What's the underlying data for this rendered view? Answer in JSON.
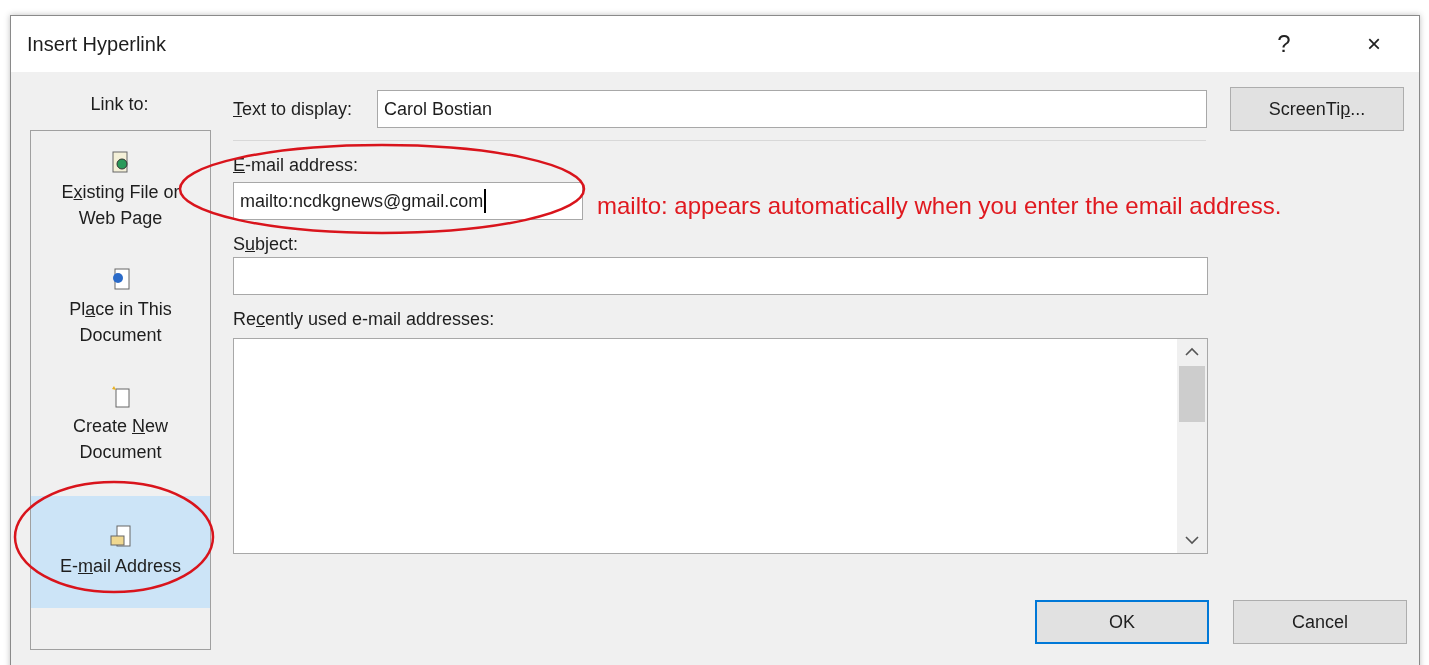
{
  "window": {
    "title": "Insert Hyperlink",
    "help": "?",
    "close": "×"
  },
  "link_to": {
    "heading": "Link to:",
    "items": [
      {
        "kind": "existing",
        "label_lines": [
          {
            "pre": "E",
            "key": "x",
            "post": "isting File or"
          },
          {
            "pre": "Web Page"
          }
        ],
        "selected": false
      },
      {
        "kind": "place",
        "label_lines": [
          {
            "pre": "Pl",
            "key": "a",
            "post": "ce in This"
          },
          {
            "pre": "Document"
          }
        ],
        "selected": false
      },
      {
        "kind": "new",
        "label_lines": [
          {
            "pre": "Create ",
            "key": "N",
            "post": "ew"
          },
          {
            "pre": "Document"
          }
        ],
        "selected": false
      },
      {
        "kind": "email",
        "label_lines": [
          {
            "pre": "E-",
            "key": "m",
            "post": "ail Address"
          }
        ],
        "selected": true
      }
    ]
  },
  "text_to_display": {
    "label": {
      "key": "T",
      "post": "ext to display:"
    },
    "value": "Carol Bostian"
  },
  "screentip_button": {
    "pre": "ScreenTi",
    "key": "p",
    "post": "..."
  },
  "email_address": {
    "label": {
      "key": "E",
      "post": "-mail address:"
    },
    "value": "mailto:ncdkgnews@gmail.com",
    "focused": true
  },
  "subject": {
    "label": {
      "pre": "S",
      "key": "u",
      "post": "bject:"
    }
  },
  "recent_addresses": {
    "label": {
      "pre": "Re",
      "key": "c",
      "post": "ently used e-mail addresses:"
    }
  },
  "buttons": [
    {
      "label": "OK",
      "default": true
    },
    {
      "label": "Cancel",
      "default": false
    }
  ],
  "annotation": {
    "note": "mailto: appears automatically when you enter the email address."
  }
}
